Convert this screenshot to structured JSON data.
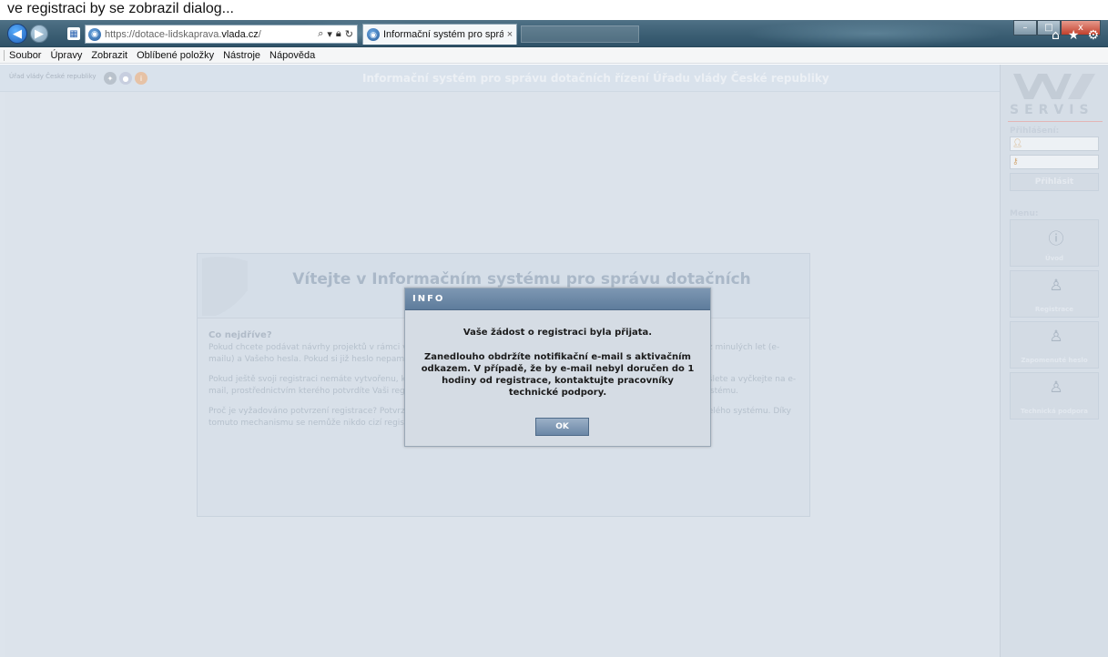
{
  "top_caption": "ve registraci by se zobrazil dialog...",
  "browser": {
    "url_host": "https://dotace-lidskaprava.",
    "url_domain": "vlada.cz",
    "url_path": "/",
    "tab_title": "Informační systém pro sprá...",
    "tab_close": "×",
    "window_min": "–",
    "window_max": "□",
    "window_close": "x",
    "icons": [
      "home-icon",
      "star-icon",
      "gear-icon"
    ]
  },
  "menubar": {
    "items": [
      "Soubor",
      "Úpravy",
      "Zobrazit",
      "Oblíbené položky",
      "Nástroje",
      "Nápověda"
    ]
  },
  "page": {
    "org_name": "Úřad vlády České republiky",
    "system_title": "Informační systém pro správu dotačních řízení Úřadu vlády České republiky"
  },
  "welcome": {
    "title": "Vítejte v Informačním systému pro správu dotačních řízení Ú",
    "heading": "Co nejdříve?",
    "para1": "Pokud chcete podávat návrhy projektů v rámci vyhlášení jakéhokoliv dotačního titulu, přihlaste se pomocí Vaší registrace z minulých let (e-mailu) a Vašeho hesla. Pokud si již heslo nepamatujete, klikněte na tlačítko „Zapomenuté heslo“.",
    "para2": "Pokud ještě svoji registraci nemáte vytvořenu, klikněte na tlačítko „Registrace“, vyplňte požadované údaje, registraci odešlete a vyčkejte na e-mail, prostřednictvím kterého potvrdíte Vaši registraci a na základě tohoto potvrzení Vám již nic nebrání v přihlášení do systému.",
    "para3": "Proč je vyžadováno potvrzení registrace? Potvrzení registrace je vyžadováno z důvodu zvýšení bezpečnosti Vašich dat a celého systému. Díky tomuto mechanismu se nemůže nikdo cizí registrovat ani vystupovat pod Vaším jménem (e-mailem)."
  },
  "modal": {
    "title": "INFO",
    "line1": "Vaše žádost o registraci byla přijata.",
    "line2": "Zanedlouho obdržíte notifikační e-mail s aktivačním odkazem. V případě, že by e-mail nebyl doručen do 1 hodiny od registrace, kontaktujte pracovníky technické podpory.",
    "ok_label": "OK"
  },
  "sidebar": {
    "brand": "SERVIS",
    "login_label": "Přihlášení:",
    "login_button": "Přihlásit",
    "menu_label": "Menu:",
    "menu_items": [
      "Úvod",
      "Registrace",
      "Zapomenuté heslo",
      "Technická podpora"
    ]
  },
  "colors": {
    "chrome": "#3d6075",
    "page_bg": "#dde4ec",
    "modal_title": "#5e7c9c",
    "ok_button": "#6b87a6"
  }
}
